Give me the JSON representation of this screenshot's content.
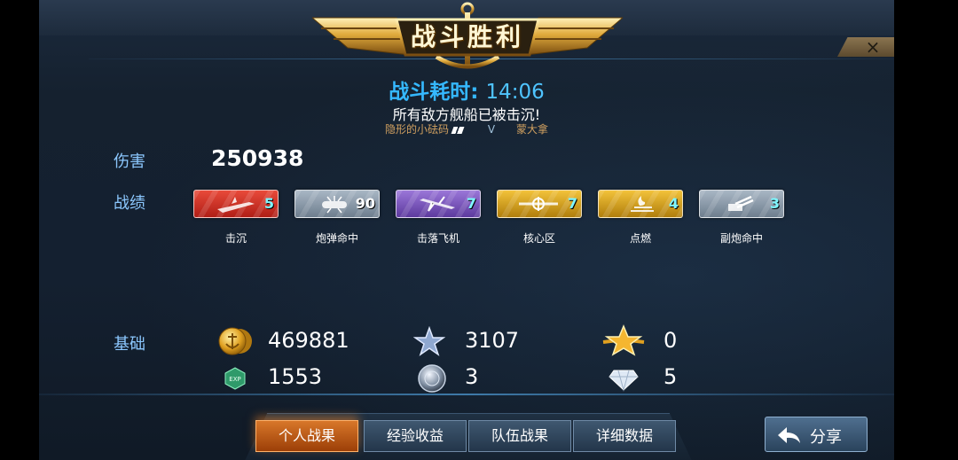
{
  "header": {
    "title": "战斗胜利",
    "close_symbol": "×"
  },
  "summary": {
    "time_label": "战斗耗时:",
    "time_value": "14:06",
    "result_message": "所有敌方舰船已被击沉!",
    "player_left": "隐形的小砝码",
    "vs": "V",
    "player_right": "蒙大拿"
  },
  "damage": {
    "label": "伤害",
    "value": "250938"
  },
  "record": {
    "label": "战绩",
    "badges": [
      {
        "label": "击沉",
        "count": "5",
        "color": "#d8352a",
        "icon": "ship-sinking-icon"
      },
      {
        "label": "炮弹命中",
        "count": "90",
        "color": "#7f8ea0",
        "icon": "shell-hit-icon"
      },
      {
        "label": "击落飞机",
        "count": "7",
        "color": "#7b55b8",
        "icon": "plane-down-icon"
      },
      {
        "label": "核心区",
        "count": "7",
        "color": "#d6a21c",
        "icon": "citadel-icon"
      },
      {
        "label": "点燃",
        "count": "4",
        "color": "#d6a21c",
        "icon": "fire-icon"
      },
      {
        "label": "副炮命中",
        "count": "3",
        "color": "#7f8ea0",
        "icon": "secondary-gun-icon"
      }
    ]
  },
  "base": {
    "label": "基础",
    "coins": "469881",
    "exp": "1553",
    "exp_icon_text": "EXP",
    "star_points": "3107",
    "orb": "3",
    "gold_star": "0",
    "diamond": "5"
  },
  "tabs": [
    "个人战果",
    "经验收益",
    "队伍战果",
    "详细数据"
  ],
  "share_label": "分享",
  "colors": {
    "accent_blue": "#35b8ff",
    "label_blue": "#8cc8ff",
    "active_tab": "#d8772a",
    "gold": "#d0a060"
  }
}
